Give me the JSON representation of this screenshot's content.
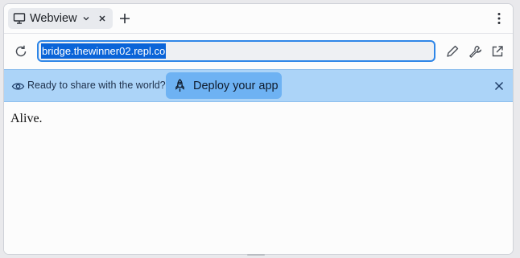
{
  "tab": {
    "label": "Webview",
    "icon": "monitor-icon"
  },
  "address_bar": {
    "url": "bridge.thewinner02.repl.co"
  },
  "banner": {
    "message": "Ready to share with the world?",
    "deploy_label": "Deploy your app"
  },
  "page": {
    "body_text": "Alive."
  },
  "colors": {
    "accent": "#2e86e8",
    "banner_bg": "#acd4f8",
    "deploy_button_bg": "#6eb2f3",
    "selection": "#0a64d8"
  }
}
